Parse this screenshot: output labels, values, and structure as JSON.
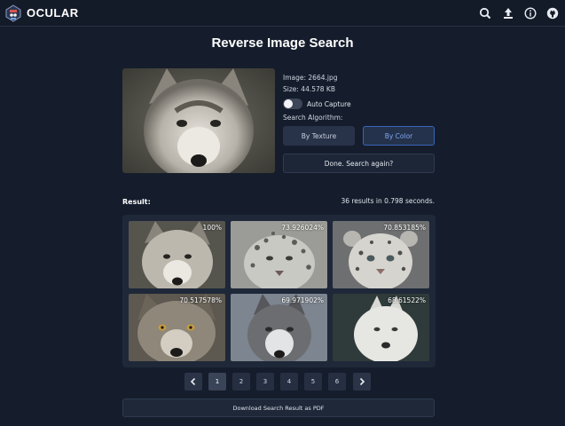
{
  "navbar": {
    "brand": "OCULAR",
    "icons": [
      "search-icon",
      "upload-icon",
      "info-icon",
      "github-icon"
    ]
  },
  "page": {
    "title": "Reverse Image Search"
  },
  "query": {
    "image_name": "Image: 2664.jpg",
    "image_size": "Size: 44.578 KB",
    "auto_capture_label": "Auto Capture",
    "auto_capture_on": false,
    "algorithm_label": "Search Algorithm:",
    "buttons": {
      "texture": "By Texture",
      "color": "By Color",
      "search_again": "Done. Search again?"
    },
    "selected_algorithm": "By Color"
  },
  "results": {
    "label": "Result:",
    "stats": "36 results in 0.798 seconds.",
    "items": [
      {
        "score": "100%"
      },
      {
        "score": "73.926024%"
      },
      {
        "score": "70.853185%"
      },
      {
        "score": "70.517578%"
      },
      {
        "score": "69.971902%"
      },
      {
        "score": "68.61522%"
      }
    ]
  },
  "pagination": {
    "prev_icon": "chevron-left-icon",
    "next_icon": "chevron-right-icon",
    "pages": [
      "1",
      "2",
      "3",
      "4",
      "5",
      "6"
    ],
    "current": "1"
  },
  "download_pdf_label": "Download Search Result as PDF",
  "colors": {
    "background": "#151d2c",
    "accent": "#3a64b8",
    "panel": "#1e2839"
  }
}
